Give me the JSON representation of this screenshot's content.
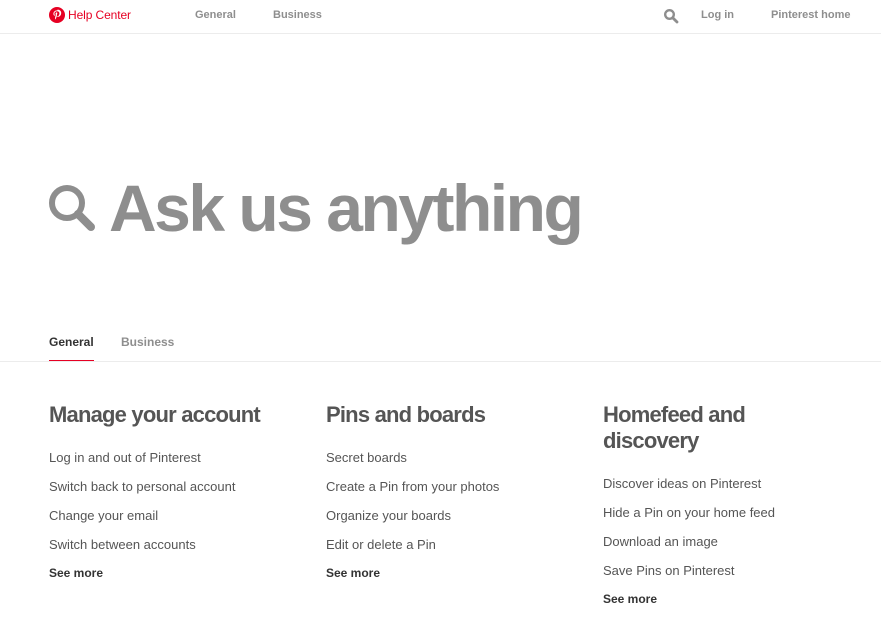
{
  "header": {
    "brand_label": "Help Center",
    "nav": [
      "General",
      "Business"
    ],
    "login_label": "Log in",
    "home_label": "Pinterest home"
  },
  "hero": {
    "placeholder": "Ask us anything"
  },
  "tabs": [
    {
      "label": "General",
      "active": true
    },
    {
      "label": "Business",
      "active": false
    }
  ],
  "sections": [
    {
      "title": "Manage your account",
      "links": [
        "Log in and out of Pinterest",
        "Switch back to personal account",
        "Change your email",
        "Switch between accounts"
      ],
      "see_more": "See more"
    },
    {
      "title": "Pins and boards",
      "links": [
        "Secret boards",
        "Create a Pin from your photos",
        "Organize your boards",
        "Edit or delete a Pin"
      ],
      "see_more": "See more"
    },
    {
      "title": "Homefeed and discovery",
      "links": [
        "Discover ideas on Pinterest",
        "Hide a Pin on your home feed",
        "Download an image",
        "Save Pins on Pinterest"
      ],
      "see_more": "See more"
    }
  ],
  "colors": {
    "brand": "#e60023",
    "muted": "#8e8e8e",
    "text": "#333333",
    "divider": "#ececec"
  },
  "icons": {
    "brand": "pinterest-logo-icon",
    "header_search": "search-icon",
    "hero_search": "search-icon"
  }
}
